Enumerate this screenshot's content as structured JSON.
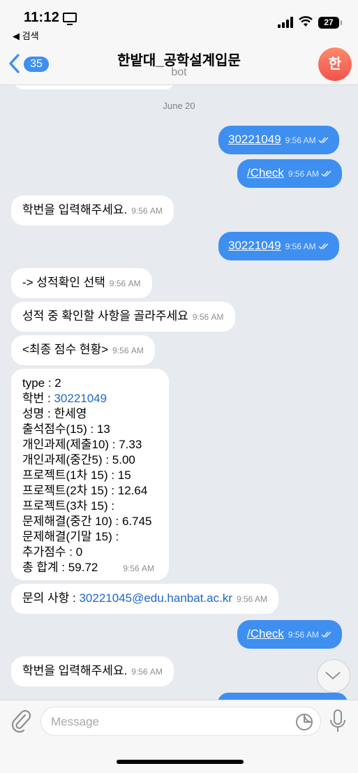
{
  "status_bar": {
    "time": "11:12",
    "back_app": "◀ 검색",
    "battery": "27"
  },
  "header": {
    "unread_count": "35",
    "title": "한밭대_공학설계입문",
    "subtitle": "bot",
    "avatar_letter": "한"
  },
  "chat": {
    "date": "June 20",
    "messages": [
      {
        "dir": "out",
        "text": "30221049",
        "time": "9:56 AM"
      },
      {
        "dir": "out",
        "text": "/Check",
        "time": "9:56 AM"
      },
      {
        "dir": "in",
        "text": "학번을 입력해주세요.",
        "time": "9:56 AM"
      },
      {
        "dir": "out",
        "text": "30221049",
        "time": "9:56 AM"
      },
      {
        "dir": "in",
        "text": "-> 성적확인 선택",
        "time": "9:56 AM"
      },
      {
        "dir": "in",
        "text": "성적 중 확인할 사항을 골라주세요",
        "time": "9:56 AM"
      },
      {
        "dir": "in",
        "text": "<최종 점수 현황>",
        "time": "9:56 AM"
      },
      {
        "dir": "in",
        "lines": [
          "type : 2",
          "학번 : ",
          "성명 : 한세영",
          "출석점수(15) : 13",
          "개인과제(제출10) : 7.33",
          "개인과제(중간5) : 5.00",
          "프로젝트(1차 15) : 15",
          "프로젝트(2차 15) : 12.64",
          "프로젝트(3차 15) :",
          "문제해결(중간 10) : 6.745",
          "문제해결(기말 15) :",
          "추가점수 : 0",
          "총 합계 : 59.72"
        ],
        "student_id_link": "30221049",
        "time": "9:56 AM"
      },
      {
        "dir": "in",
        "prefix": "문의 사항 : ",
        "email": "30221045@edu.hanbat.ac.kr",
        "time": "9:56 AM"
      },
      {
        "dir": "out",
        "text": "/Check",
        "time": "9:56 AM"
      },
      {
        "dir": "in",
        "text": "학번을 입력해주세요.",
        "time": "9:56 AM"
      }
    ]
  },
  "input": {
    "placeholder": "Message"
  }
}
